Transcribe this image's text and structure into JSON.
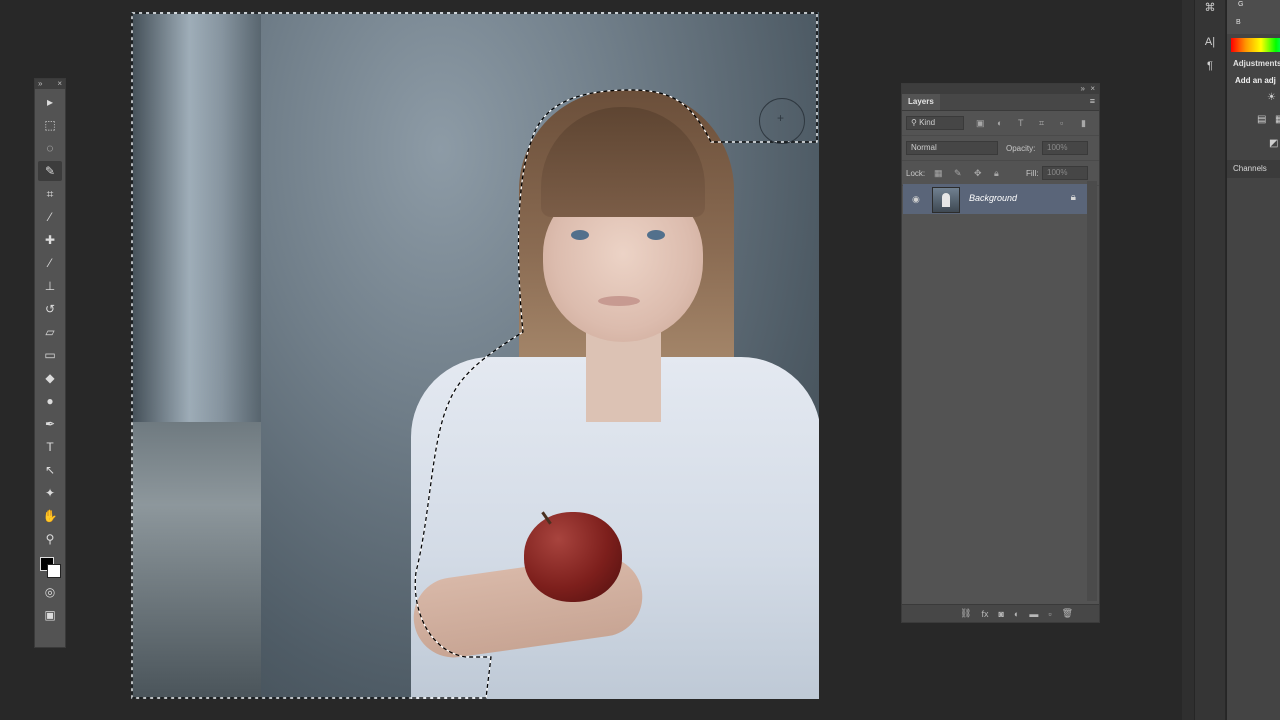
{
  "tools_panel": {
    "grip_expand": "»",
    "grip_close": "×",
    "tools": [
      {
        "name": "move-tool-icon",
        "glyph": "▸"
      },
      {
        "name": "marquee-tool-icon",
        "glyph": "⬚"
      },
      {
        "name": "lasso-tool-icon",
        "glyph": "◌"
      },
      {
        "name": "quick-selection-tool-icon",
        "glyph": "✎"
      },
      {
        "name": "crop-tool-icon",
        "glyph": "⌗"
      },
      {
        "name": "eyedropper-tool-icon",
        "glyph": "⁄"
      },
      {
        "name": "healing-brush-tool-icon",
        "glyph": "✚"
      },
      {
        "name": "brush-tool-icon",
        "glyph": "⁄"
      },
      {
        "name": "clone-stamp-tool-icon",
        "glyph": "⊥"
      },
      {
        "name": "history-brush-tool-icon",
        "glyph": "↺"
      },
      {
        "name": "eraser-tool-icon",
        "glyph": "▱"
      },
      {
        "name": "gradient-tool-icon",
        "glyph": "▭"
      },
      {
        "name": "blur-tool-icon",
        "glyph": "◆"
      },
      {
        "name": "dodge-tool-icon",
        "glyph": "●"
      },
      {
        "name": "pen-tool-icon",
        "glyph": "✒"
      },
      {
        "name": "type-tool-icon",
        "glyph": "T"
      },
      {
        "name": "path-selection-tool-icon",
        "glyph": "↖"
      },
      {
        "name": "shape-tool-icon",
        "glyph": "✦"
      },
      {
        "name": "hand-tool-icon",
        "glyph": "✋"
      },
      {
        "name": "zoom-tool-icon",
        "glyph": "⚲"
      }
    ],
    "active_tool": "quick-selection-tool-icon",
    "extra": [
      {
        "name": "quick-mask-icon",
        "glyph": "◎"
      },
      {
        "name": "screen-mode-icon",
        "glyph": "▣"
      }
    ],
    "foreground_color": "#000000",
    "background_color": "#ffffff"
  },
  "layers_panel": {
    "tab_label": "Layers",
    "filter_kind": "Kind",
    "blend_mode": "Normal",
    "opacity_label": "Opacity:",
    "opacity_value": "100%",
    "lock_label": "Lock:",
    "fill_label": "Fill:",
    "fill_value": "100%",
    "layer": {
      "name": "Background",
      "visible": true,
      "locked": true
    },
    "bottom_icons": [
      "link-layers-icon",
      "fx-icon",
      "add-mask-icon",
      "adjustment-layer-icon",
      "group-icon",
      "new-layer-icon",
      "delete-layer-icon"
    ],
    "bottom_glyphs": [
      "⛓",
      "fx",
      "◙",
      "◐",
      "▬",
      "▫",
      "🗑"
    ]
  },
  "right_dock": {
    "color_labels": [
      "G",
      "B"
    ],
    "adjustments_title": "Adjustments",
    "adjustments_sub": "Add an adj",
    "channels_label": "Channels"
  },
  "canvas": {
    "brush_cursor": "circle"
  }
}
